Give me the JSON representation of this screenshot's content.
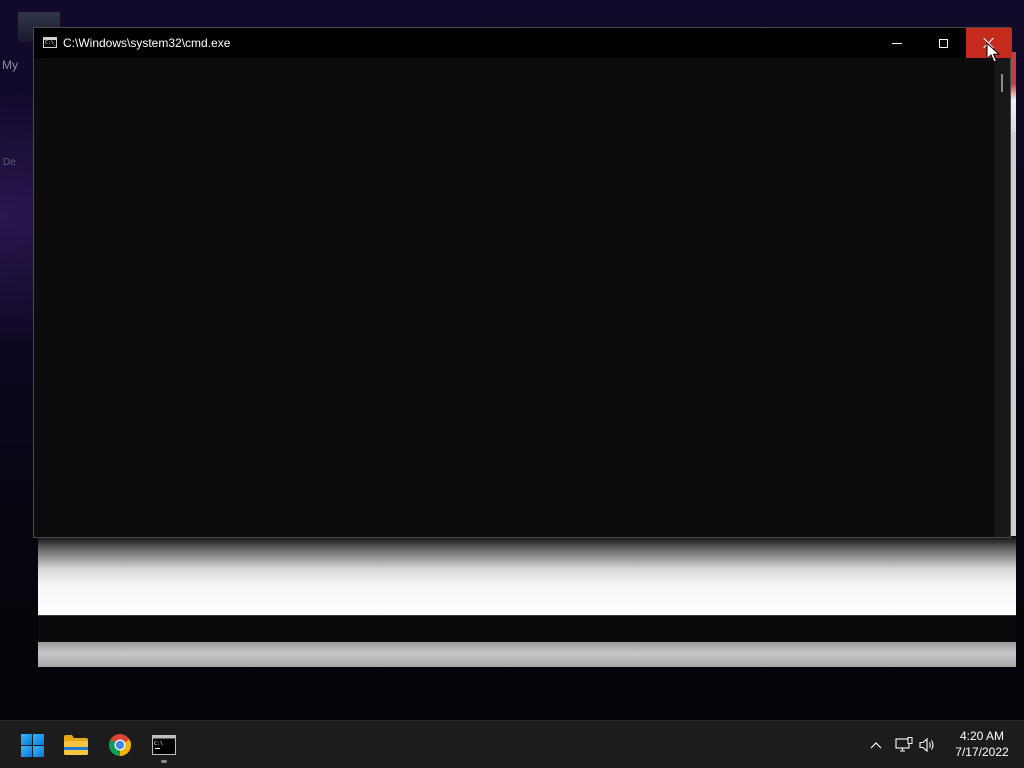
{
  "desktop": {
    "icon_label_1": "My",
    "icon_label_2": "De"
  },
  "cmd_window": {
    "title": "C:\\Windows\\system32\\cmd.exe",
    "minimize_label": "Minimize",
    "maximize_label": "Maximize",
    "close_label": "Close",
    "close_hover_color": "#c42b1c",
    "background_color": "#0c0c0c"
  },
  "taskbar": {
    "apps": [
      {
        "name": "Start",
        "icon": "windows-logo-icon"
      },
      {
        "name": "File Explorer",
        "icon": "folder-icon"
      },
      {
        "name": "Google Chrome",
        "icon": "chrome-icon"
      },
      {
        "name": "Command Prompt",
        "icon": "cmd-icon",
        "running": true
      }
    ],
    "tray": {
      "icons": [
        "chevron-up-icon",
        "network-icon",
        "volume-icon"
      ],
      "time": "4:20 AM",
      "date": "7/17/2022"
    }
  }
}
